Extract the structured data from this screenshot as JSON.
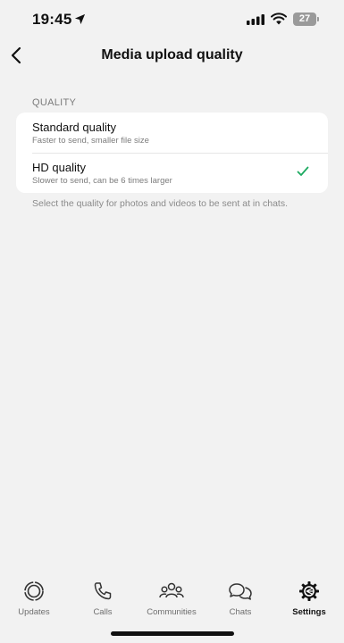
{
  "status_bar": {
    "time": "19:45",
    "battery": "27"
  },
  "nav": {
    "title": "Media upload quality",
    "back_icon": "chevron-left-icon"
  },
  "quality": {
    "header": "QUALITY",
    "options": [
      {
        "title": "Standard quality",
        "subtitle": "Faster to send, smaller file size",
        "selected": false
      },
      {
        "title": "HD quality",
        "subtitle": "Slower to send, can be 6 times larger",
        "selected": true
      }
    ],
    "note": "Select the quality for photos and videos to be sent at in chats."
  },
  "tabs": [
    {
      "label": "Updates",
      "icon": "updates-icon",
      "active": false
    },
    {
      "label": "Calls",
      "icon": "phone-icon",
      "active": false
    },
    {
      "label": "Communities",
      "icon": "communities-icon",
      "active": false
    },
    {
      "label": "Chats",
      "icon": "chats-icon",
      "active": false
    },
    {
      "label": "Settings",
      "icon": "settings-icon",
      "active": true
    }
  ],
  "colors": {
    "background": "#f2f2f2",
    "accent": "#1daa61"
  }
}
